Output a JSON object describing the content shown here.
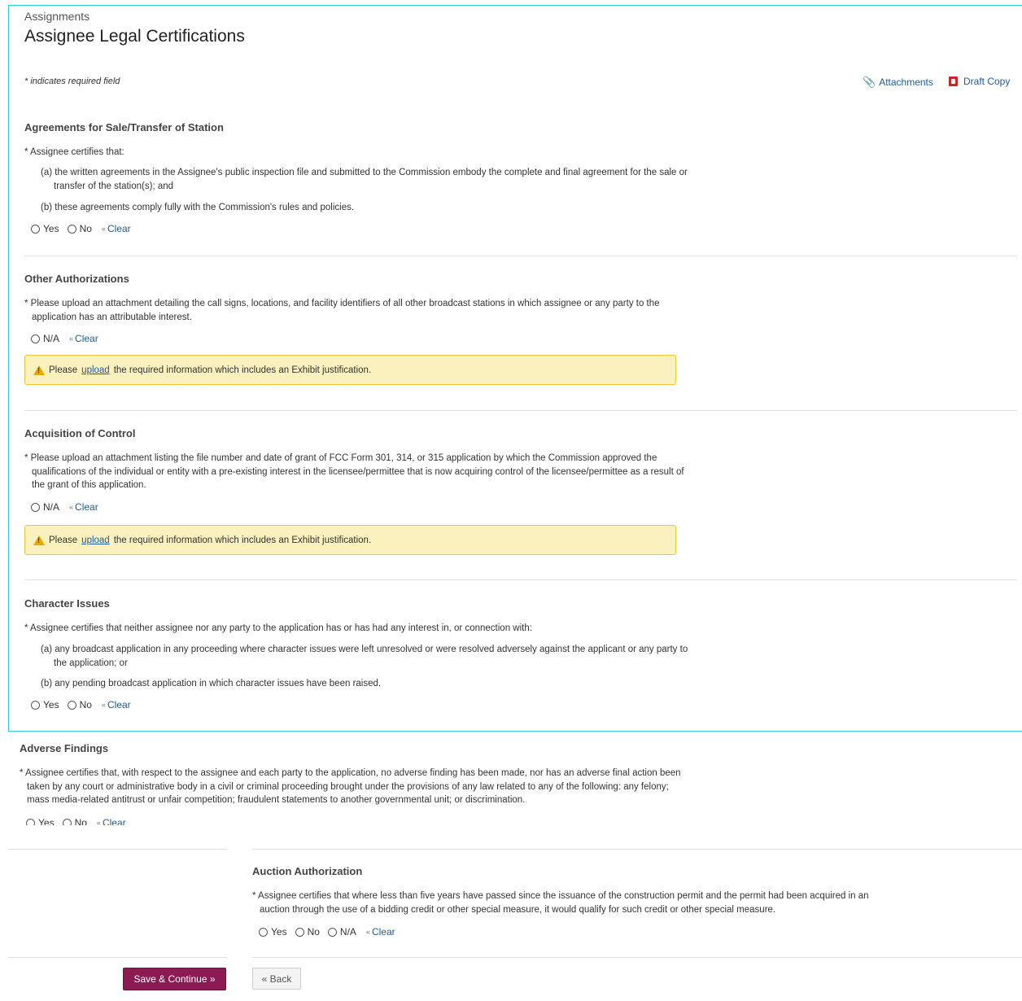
{
  "header": {
    "breadcrumb": "Assignments",
    "title": "Assignee Legal Certifications",
    "required_note": "* indicates required field",
    "attachments_label": "Attachments",
    "draft_copy_label": "Draft Copy"
  },
  "sections": {
    "sale": {
      "title": "Agreements for Sale/Transfer of Station",
      "question": "* Assignee certifies that:",
      "item_a": "(a) the written agreements in the Assignee's public inspection file and submitted to the Commission embody the complete and final agreement for the sale or transfer of the station(s); and",
      "item_b": "(b) these agreements comply fully with the Commission's rules and policies.",
      "options": [
        "Yes",
        "No"
      ],
      "clear": "Clear"
    },
    "other_auth": {
      "title": "Other Authorizations",
      "question": "* Please upload an attachment detailing the call signs, locations, and facility identifiers of all other broadcast stations in which assignee or any party to the application has an attributable interest.",
      "options": [
        "N/A"
      ],
      "clear": "Clear",
      "warning_prefix": "Please",
      "warning_link": "upload",
      "warning_suffix": "the required information which includes an Exhibit justification."
    },
    "acquisition": {
      "title": "Acquisition of Control",
      "question": "* Please upload an attachment listing the file number and date of grant of FCC Form 301, 314, or 315 application by which the Commission approved the qualifications of the individual or entity with a pre-existing interest in the licensee/permittee that is now acquiring control of the licensee/permittee as a result of the grant of this application.",
      "options": [
        "N/A"
      ],
      "clear": "Clear",
      "warning_prefix": "Please",
      "warning_link": "upload",
      "warning_suffix": "the required information which includes an Exhibit justification."
    },
    "character": {
      "title": "Character Issues",
      "question": "* Assignee certifies that neither assignee nor any party to the application has or has had any interest in, or connection with:",
      "item_a": "(a) any broadcast application in any proceeding where character issues were left unresolved or were resolved adversely against the applicant or any party to the application; or",
      "item_b": "(b) any pending broadcast application in which character issues have been raised.",
      "options": [
        "Yes",
        "No"
      ],
      "clear": "Clear"
    },
    "adverse": {
      "title": "Adverse Findings",
      "question": "* Assignee certifies that, with respect to the assignee and each party to the application, no adverse finding has been made, nor has an adverse final action been taken by any court or administrative body in a civil or criminal proceeding brought under the provisions of any law related to any of the following: any felony; mass media-related antitrust or unfair competition; fraudulent statements to another governmental unit; or discrimination.",
      "options": [
        "Yes",
        "No"
      ],
      "clear": "Clear"
    },
    "auction": {
      "title": "Auction Authorization",
      "question": "* Assignee certifies that where less than five years have passed since the issuance of the construction permit and the permit had been acquired in an auction through the use of a bidding credit or other special measure, it would qualify for such credit or other special measure.",
      "options": [
        "Yes",
        "No",
        "N/A"
      ],
      "clear": "Clear"
    }
  },
  "footer": {
    "save_label": "Save & Continue »",
    "back_label": "« Back"
  },
  "colors": {
    "frame_border": "#36c9e0",
    "primary_button": "#8c1a53",
    "warning_bg": "#fbf1be",
    "warning_border": "#f1c33b",
    "link": "#1a5b9c"
  }
}
